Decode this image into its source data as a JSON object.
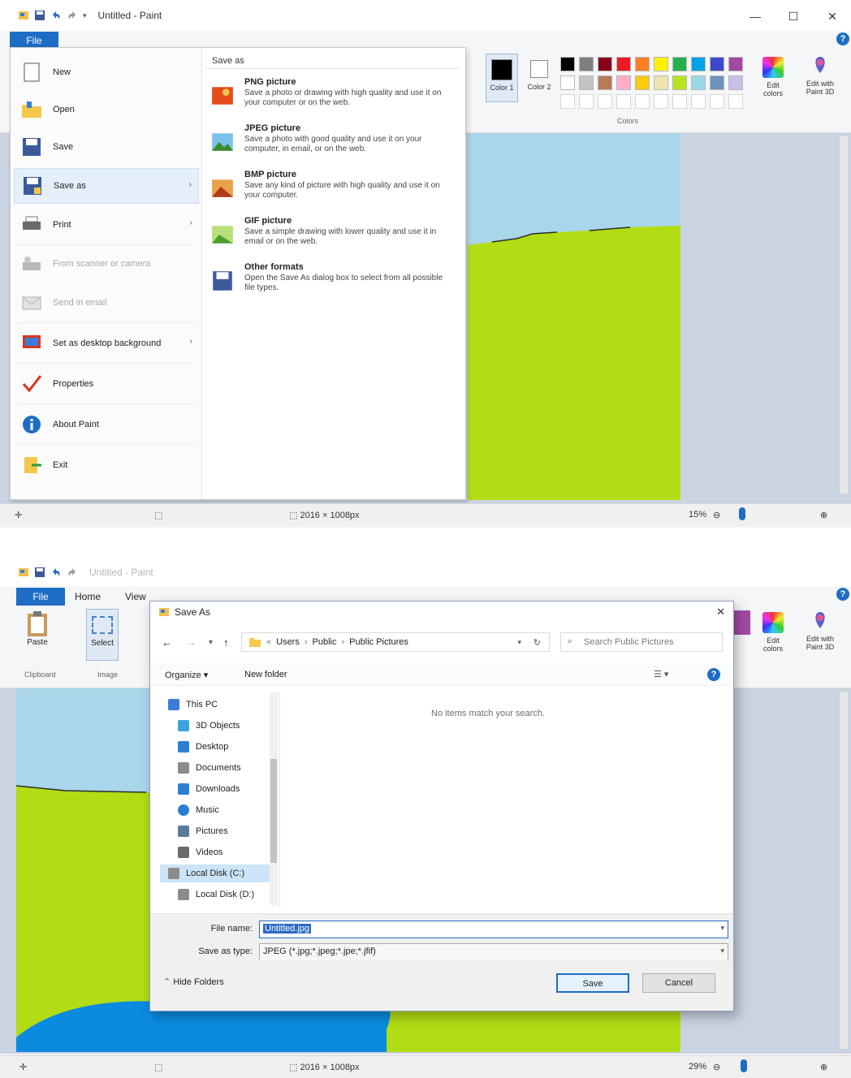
{
  "window": {
    "title": "Untitled - Paint",
    "title_faded": "Untitled - Paint",
    "minimize": "—",
    "maximize": "☐",
    "close": "✕"
  },
  "ribbon": {
    "file_tab": "File",
    "home_tab": "Home",
    "view_tab": "View",
    "help": "?",
    "colors_group": "Colors",
    "color1_label": "Color 1",
    "color2_label": "Color 2",
    "edit_colors": "Edit colors",
    "edit_paint3d": "Edit with Paint 3D",
    "clipboard_group": "Clipboard",
    "image_group": "Image",
    "paste_label": "Paste",
    "select_label": "Select",
    "palette": [
      "#000000",
      "#7f7f7f",
      "#880015",
      "#ed1c24",
      "#ff7f27",
      "#fff200",
      "#22b14c",
      "#00a2e8",
      "#3f48cc",
      "#a349a4",
      "#ffffff",
      "#c3c3c3",
      "#b97a57",
      "#ffaec9",
      "#ffc90e",
      "#efe4b0",
      "#b5e61d",
      "#99d9ea",
      "#7092be",
      "#c8bfe7"
    ]
  },
  "file_menu": {
    "items": [
      {
        "label": "New",
        "icon": "new-file-icon"
      },
      {
        "label": "Open",
        "icon": "open-folder-icon"
      },
      {
        "label": "Save",
        "icon": "save-icon"
      },
      {
        "label": "Save as",
        "icon": "save-as-icon",
        "arrow": "›"
      },
      {
        "label": "Print",
        "icon": "printer-icon",
        "arrow": "›"
      },
      {
        "label": "From scanner or camera",
        "icon": "scanner-icon"
      },
      {
        "label": "Send in email",
        "icon": "email-icon"
      },
      {
        "label": "Set as desktop background",
        "icon": "desktop-background-icon",
        "arrow": "›"
      },
      {
        "label": "Properties",
        "icon": "properties-icon"
      },
      {
        "label": "About Paint",
        "icon": "info-icon"
      },
      {
        "label": "Exit",
        "icon": "exit-icon"
      }
    ],
    "save_as_heading": "Save as",
    "save_as_options": [
      {
        "title": "PNG picture",
        "desc": "Save a photo or drawing with high quality and use it on your computer or on the web.",
        "icon": "png-picture-icon"
      },
      {
        "title": "JPEG picture",
        "desc": "Save a photo with good quality and use it on your computer, in email, or on the web.",
        "icon": "jpeg-picture-icon"
      },
      {
        "title": "BMP picture",
        "desc": "Save any kind of picture with high quality and use it on your computer.",
        "icon": "bmp-picture-icon"
      },
      {
        "title": "GIF picture",
        "desc": "Save a simple drawing with lower quality and use it in email or on the web.",
        "icon": "gif-picture-icon"
      },
      {
        "title": "Other formats",
        "desc": "Open the Save As dialog box to select from all possible file types.",
        "icon": "other-formats-icon"
      }
    ]
  },
  "status_top": {
    "dimensions": "2016 × 1008px",
    "zoom": "15%"
  },
  "status_bottom": {
    "dimensions": "2016 × 1008px",
    "zoom": "29%"
  },
  "dialog": {
    "title": "Save As",
    "close": "✕",
    "back": "←",
    "forward": "→",
    "up": "↑",
    "breadcrumb": [
      "Users",
      "Public",
      "Public Pictures"
    ],
    "search_placeholder": "Search Public Pictures",
    "organize": "Organize ▾",
    "new_folder": "New folder",
    "view_menu": "☰ ▾",
    "help": "?",
    "tree": [
      {
        "label": "This PC",
        "icon": "computer-icon"
      },
      {
        "label": "3D Objects",
        "icon": "cube-icon"
      },
      {
        "label": "Desktop",
        "icon": "desktop-icon"
      },
      {
        "label": "Documents",
        "icon": "documents-icon"
      },
      {
        "label": "Downloads",
        "icon": "download-icon"
      },
      {
        "label": "Music",
        "icon": "music-icon"
      },
      {
        "label": "Pictures",
        "icon": "pictures-icon"
      },
      {
        "label": "Videos",
        "icon": "videos-icon"
      },
      {
        "label": "Local Disk (C:)",
        "icon": "drive-icon"
      },
      {
        "label": "Local Disk (D:)",
        "icon": "drive-icon"
      }
    ],
    "empty_message": "No items match your search.",
    "file_name_label": "File name:",
    "file_name_value": "Untitled.jpg",
    "save_type_label": "Save as type:",
    "save_type_value": "JPEG (*.jpg;*.jpeg;*.jpe;*.jfif)",
    "hide_folders": "Hide Folders",
    "save": "Save",
    "cancel": "Cancel"
  }
}
